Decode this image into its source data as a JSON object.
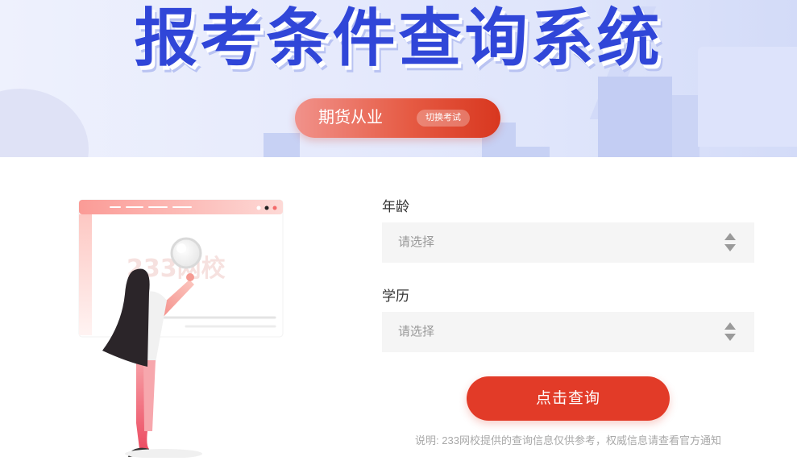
{
  "banner": {
    "title": "报考条件查询系统",
    "exam_name": "期货从业",
    "switch_label": "切换考试"
  },
  "illustration": {
    "watermark": "233网校"
  },
  "form": {
    "age_label": "年龄",
    "age_placeholder": "请选择",
    "education_label": "学历",
    "education_placeholder": "请选择",
    "submit_label": "点击查询",
    "note": "说明: 233网校提供的查询信息仅供参考，权威信息请查看官方通知"
  },
  "colors": {
    "title_blue": "#3046d8",
    "accent_red": "#e23b28",
    "banner_bg": "#e6eafc"
  }
}
